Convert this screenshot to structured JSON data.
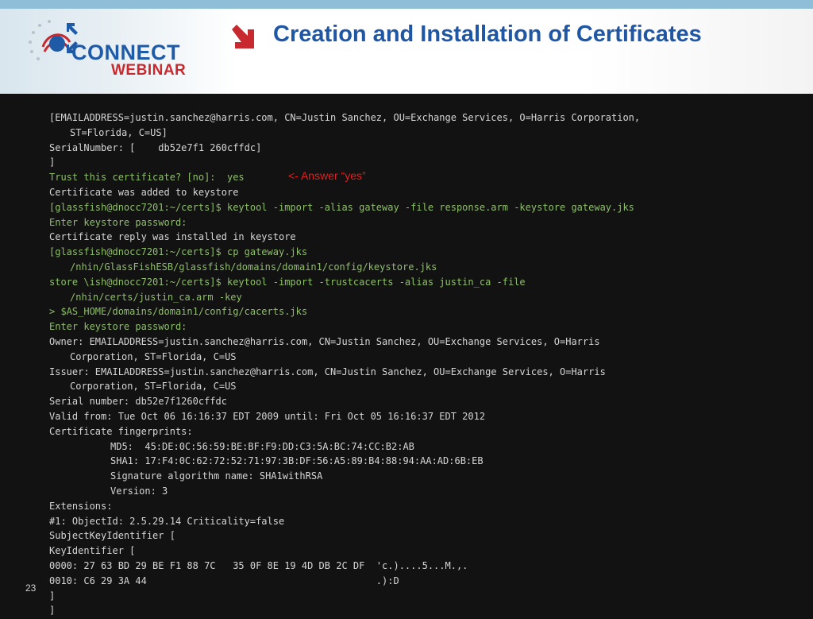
{
  "slide": {
    "title": "Creation and Installation of Certificates",
    "page_number": "23",
    "annotation": "<- Answer “yes”",
    "colors": {
      "title": "#1f57a4",
      "accent_arrow": "#c8292e",
      "terminal_bg": "#121212",
      "terminal_text": "#d6d6d6",
      "terminal_prompt": "#8fbf6a",
      "annotation": "#e02020"
    }
  },
  "logo": {
    "connect": "CONNECT",
    "webinar": "WEBINAR",
    "icon": "globe-stars-arrows-icon"
  },
  "terminal": {
    "lines": [
      {
        "text": "[EMAILADDRESS=justin.sanchez@harris.com, CN=Justin Sanchez, OU=Exchange Services, O=Harris Corporation,",
        "style": "white"
      },
      {
        "text": "ST=Florida, C=US]",
        "style": "white",
        "indent": "1"
      },
      {
        "text": "SerialNumber: [    db52e7f1 260cffdc]",
        "style": "white"
      },
      {
        "text": "]",
        "style": "white"
      },
      {
        "text": "Trust this certificate? [no]:  yes",
        "style": "green"
      },
      {
        "text": "Certificate was added to keystore",
        "style": "white"
      },
      {
        "text": "[glassfish@dnocc7201:~/certs]$ keytool -import -alias gateway -file response.arm -keystore gateway.jks",
        "style": "green"
      },
      {
        "text": "Enter keystore password:",
        "style": "green"
      },
      {
        "text": "Certificate reply was installed in keystore",
        "style": "white"
      },
      {
        "text": "[glassfish@dnocc7201:~/certs]$ cp gateway.jks",
        "style": "green"
      },
      {
        "text": "/nhin/GlassFishESB/glassfish/domains/domain1/config/keystore.jks",
        "style": "green",
        "indent": "1"
      },
      {
        "text": "store \\ish@dnocc7201:~/certs]$ keytool -import -trustcacerts -alias justin_ca -file",
        "style": "green"
      },
      {
        "text": "/nhin/certs/justin_ca.arm -key",
        "style": "green",
        "indent": "1"
      },
      {
        "text": "> $AS_HOME/domains/domain1/config/cacerts.jks",
        "style": "green"
      },
      {
        "text": "Enter keystore password:",
        "style": "green"
      },
      {
        "text": "Owner: EMAILADDRESS=justin.sanchez@harris.com, CN=Justin Sanchez, OU=Exchange Services, O=Harris",
        "style": "white"
      },
      {
        "text": "Corporation, ST=Florida, C=US",
        "style": "white",
        "indent": "1"
      },
      {
        "text": "Issuer: EMAILADDRESS=justin.sanchez@harris.com, CN=Justin Sanchez, OU=Exchange Services, O=Harris",
        "style": "white"
      },
      {
        "text": "Corporation, ST=Florida, C=US",
        "style": "white",
        "indent": "1"
      },
      {
        "text": "Serial number: db52e7f1260cffdc",
        "style": "white"
      },
      {
        "text": "Valid from: Tue Oct 06 16:16:37 EDT 2009 until: Fri Oct 05 16:16:37 EDT 2012",
        "style": "white"
      },
      {
        "text": "Certificate fingerprints:",
        "style": "white"
      },
      {
        "text": "MD5:  45:DE:0C:56:59:BE:BF:F9:DD:C3:5A:BC:74:CC:B2:AB",
        "style": "white",
        "indent": "2"
      },
      {
        "text": "SHA1: 17:F4:0C:62:72:52:71:97:3B:DF:56:A5:89:B4:88:94:AA:AD:6B:EB",
        "style": "white",
        "indent": "2"
      },
      {
        "text": "Signature algorithm name: SHA1withRSA",
        "style": "white",
        "indent": "2"
      },
      {
        "text": "Version: 3",
        "style": "white",
        "indent": "2"
      },
      {
        "text": "Extensions:",
        "style": "white"
      },
      {
        "text": "#1: ObjectId: 2.5.29.14 Criticality=false",
        "style": "white"
      },
      {
        "text": "SubjectKeyIdentifier [",
        "style": "white"
      },
      {
        "text": "KeyIdentifier [",
        "style": "white"
      },
      {
        "text": "0000: 27 63 BD 29 BE F1 88 7C   35 0F 8E 19 4D DB 2C DF  'c.)....5...M.,.",
        "style": "white"
      },
      {
        "text": "0010: C6 29 3A 44                                        .):D",
        "style": "white"
      },
      {
        "text": "]",
        "style": "white"
      },
      {
        "text": "]",
        "style": "white"
      }
    ]
  }
}
